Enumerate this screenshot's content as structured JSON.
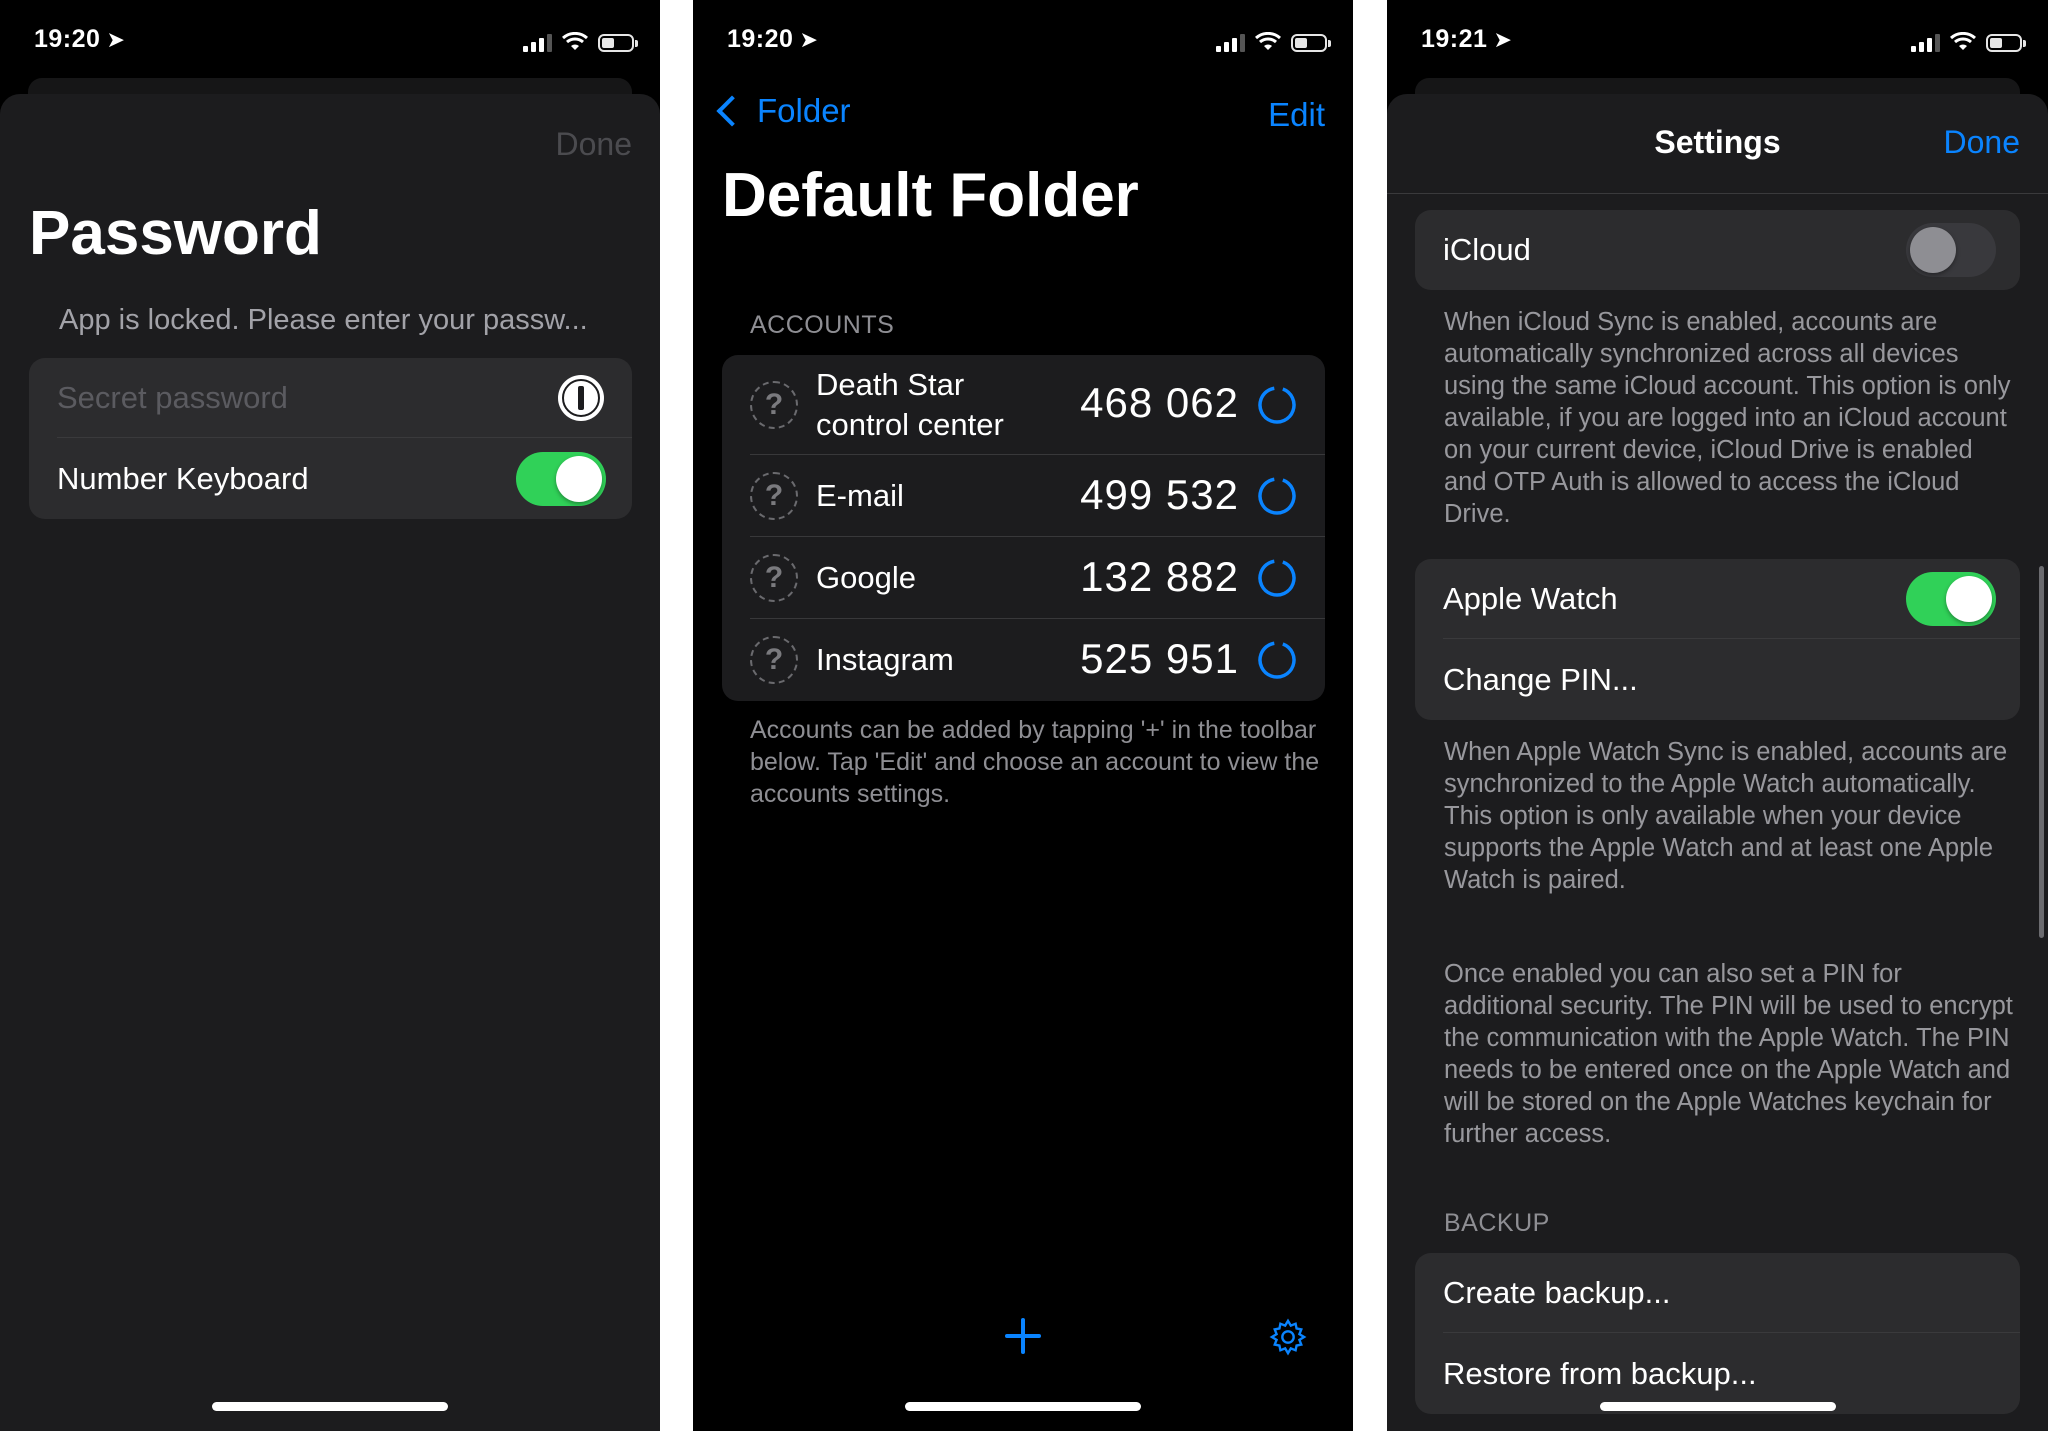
{
  "status_bars": [
    {
      "time": "19:20"
    },
    {
      "time": "19:20"
    },
    {
      "time": "19:21"
    }
  ],
  "password_screen": {
    "done_label": "Done",
    "title": "Password",
    "subtitle": "App is locked. Please enter your passw...",
    "password_placeholder": "Secret password",
    "password_icon": "1password-icon",
    "number_keyboard_label": "Number Keyboard",
    "number_keyboard_on": true
  },
  "folder_screen": {
    "back_label": "Folder",
    "edit_label": "Edit",
    "title": "Default Folder",
    "section_header": "ACCOUNTS",
    "accounts": [
      {
        "name_line1": "Death Star",
        "name_line2": "control center",
        "code": "468 062"
      },
      {
        "name_line1": "E-mail",
        "name_line2": "",
        "code": "499 532"
      },
      {
        "name_line1": "Google",
        "name_line2": "",
        "code": "132 882"
      },
      {
        "name_line1": "Instagram",
        "name_line2": "",
        "code": "525 951"
      }
    ],
    "footer": "Accounts can be added by tapping '+' in the toolbar below. Tap 'Edit' and choose an account to view the accounts settings.",
    "toolbar": {
      "add_icon": "plus-icon",
      "settings_icon": "gear-icon"
    }
  },
  "settings_screen": {
    "title": "Settings",
    "done_label": "Done",
    "icloud_label": "iCloud",
    "icloud_on": false,
    "icloud_desc": "When iCloud Sync is enabled, accounts are automatically synchronized across all devices using the same iCloud account. This option is only available, if you are logged into an iCloud account on your current device, iCloud Drive is enabled and OTP Auth is allowed to access the iCloud Drive.",
    "apple_watch_label": "Apple Watch",
    "apple_watch_on": true,
    "change_pin_label": "Change PIN...",
    "watch_desc_1": "When Apple Watch Sync is enabled, accounts are synchronized to the Apple Watch automatically. This option is only available when your device supports the Apple Watch and at least one Apple Watch is paired.",
    "watch_desc_2": "Once enabled you can also set a PIN for additional security. The PIN will be used to encrypt the communication with the Apple Watch. The PIN needs to be entered once on the Apple Watch and will be stored on the Apple Watches keychain for further access.",
    "backup_header": "BACKUP",
    "create_backup_label": "Create backup...",
    "restore_backup_label": "Restore from backup..."
  },
  "colors": {
    "accent": "#0a84ff",
    "toggle_on": "#30d158",
    "background": "#000000",
    "sheet": "#1c1c1e",
    "cell": "#2c2c2e"
  }
}
